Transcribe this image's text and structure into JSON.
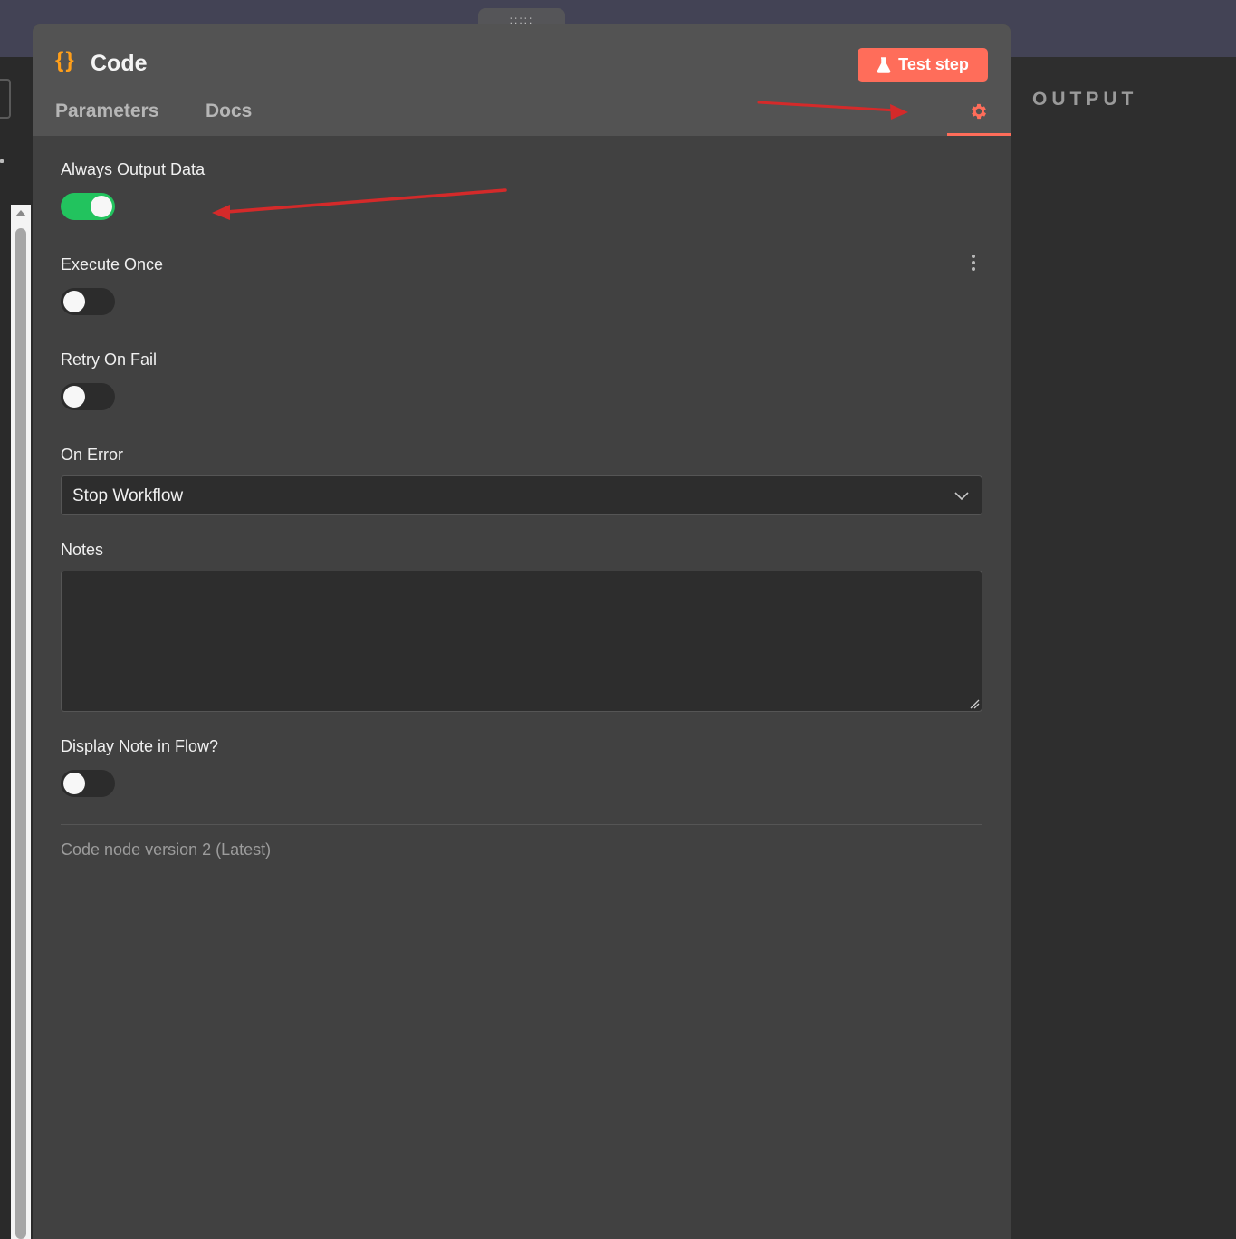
{
  "window": {
    "drag_handle": ":::::",
    "output_label": "OUTPUT"
  },
  "header": {
    "icon": "code-braces-icon",
    "icon_glyph": "{}",
    "title": "Code",
    "test_button": {
      "label": "Test step",
      "icon": "flask-icon"
    },
    "tabs": [
      {
        "label": "Parameters",
        "active": false
      },
      {
        "label": "Docs",
        "active": false
      },
      {
        "icon": "gear-icon",
        "active": true
      }
    ]
  },
  "settings": {
    "always_output_data": {
      "label": "Always Output Data",
      "enabled": true
    },
    "execute_once": {
      "label": "Execute Once",
      "enabled": false
    },
    "retry_on_fail": {
      "label": "Retry On Fail",
      "enabled": false
    },
    "on_error": {
      "label": "On Error",
      "value": "Stop Workflow"
    },
    "notes": {
      "label": "Notes",
      "value": ""
    },
    "display_note": {
      "label": "Display Note in Flow?",
      "enabled": false
    },
    "version": "Code node version 2 (Latest)"
  },
  "colors": {
    "accent": "#ff6d5a",
    "toggle_on": "#22c35e",
    "icon_orange": "#ff9f1a",
    "annotation_red": "#d42a2a"
  }
}
